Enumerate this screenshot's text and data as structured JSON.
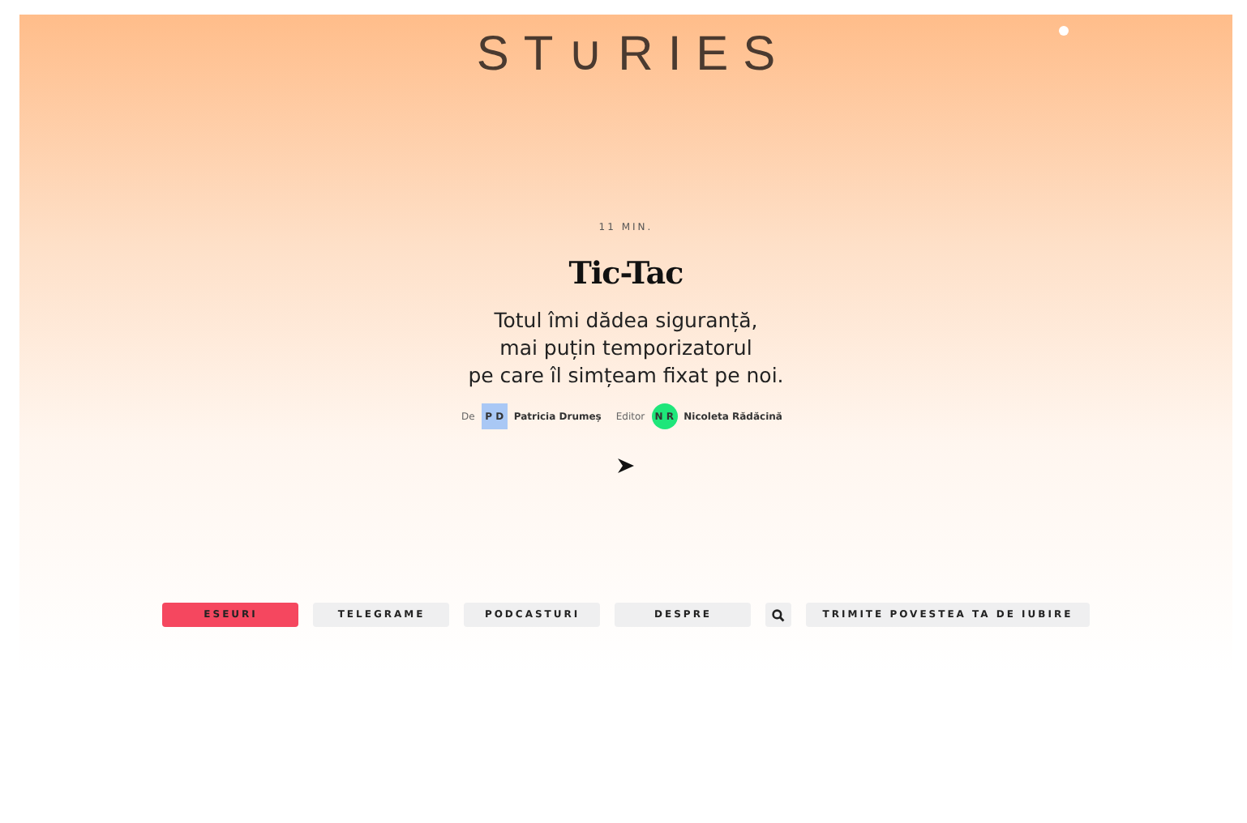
{
  "logo": "ST∪RIES",
  "article": {
    "reading_time": "11 MIN.",
    "title": "Tic-Tac",
    "lede": [
      "Totul îmi dădea siguranță,",
      "mai puțin temporizatorul",
      "pe care îl simțeam fixat pe noi."
    ],
    "credits": [
      {
        "label": "De",
        "initials": "P D",
        "name": "Patricia Drumeș",
        "color": "#a9c8f5",
        "kind": "square"
      },
      {
        "label": "Editor",
        "initials": "N R",
        "name": "Nicoleta Rădăcină",
        "color": "#1ee67a",
        "kind": "circle"
      }
    ]
  },
  "nav": [
    {
      "kind": "text",
      "label": "ESEURI",
      "selected": true
    },
    {
      "kind": "text",
      "label": "TELEGRAME",
      "selected": false
    },
    {
      "kind": "text",
      "label": "PODCASTURI",
      "selected": false
    },
    {
      "kind": "text",
      "label": "DESPRE",
      "selected": false
    },
    {
      "kind": "search",
      "selected": false
    },
    {
      "kind": "text",
      "label": "TRIMITE POVESTEA TA DE IUBIRE",
      "selected": false
    }
  ]
}
